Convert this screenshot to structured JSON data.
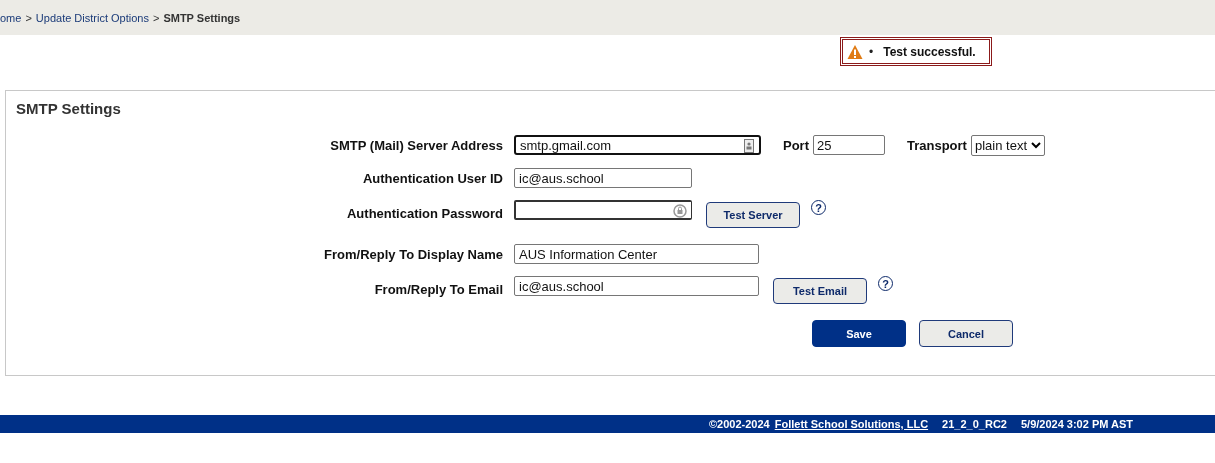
{
  "breadcrumb": [
    {
      "label": "ome",
      "link": true
    },
    {
      "label": "Update District Options",
      "link": true
    },
    {
      "label": "SMTP Settings",
      "link": false
    }
  ],
  "breadcrumb_separator": ">",
  "message": {
    "bullet": "•",
    "text": "Test successful."
  },
  "panel": {
    "title": "SMTP Settings",
    "rows": [
      {
        "label": "SMTP (Mail) Server Address",
        "field": {
          "kind": "autofill",
          "value": "smtp.gmail.com",
          "focused": true
        },
        "extras": [
          {
            "kind": "text-field",
            "label": "Port",
            "value": "25"
          },
          {
            "kind": "select",
            "label": "Transport",
            "value": "plain text"
          }
        ]
      },
      {
        "label": "Authentication User ID",
        "field": {
          "value": "ic@aus.school",
          "focused": false
        }
      },
      {
        "label": "Authentication Password",
        "field": {
          "kind": "password",
          "focused": false
        },
        "extras": [
          {
            "kind": "button",
            "label": "Test Server"
          },
          {
            "kind": "help",
            "label": "?"
          }
        ]
      },
      {
        "label": "From/Reply To Display Name",
        "field": {
          "value": "AUS Information Center",
          "focused": false
        }
      },
      {
        "label": "From/Reply To Email",
        "field": {
          "value": "ic@aus.school",
          "focused": false
        },
        "extras": [
          {
            "kind": "button",
            "label": "Test Email"
          },
          {
            "kind": "help",
            "label": "?"
          }
        ]
      }
    ],
    "buttons": [
      {
        "label": "Save",
        "primary": true
      },
      {
        "label": "Cancel",
        "primary": false
      }
    ]
  },
  "footer": {
    "copyright": "©2002-2024",
    "company": "Follett School Solutions, LLC",
    "version": "21_2_0_RC2",
    "timestamp": "5/9/2024 3:02 PM AST"
  }
}
